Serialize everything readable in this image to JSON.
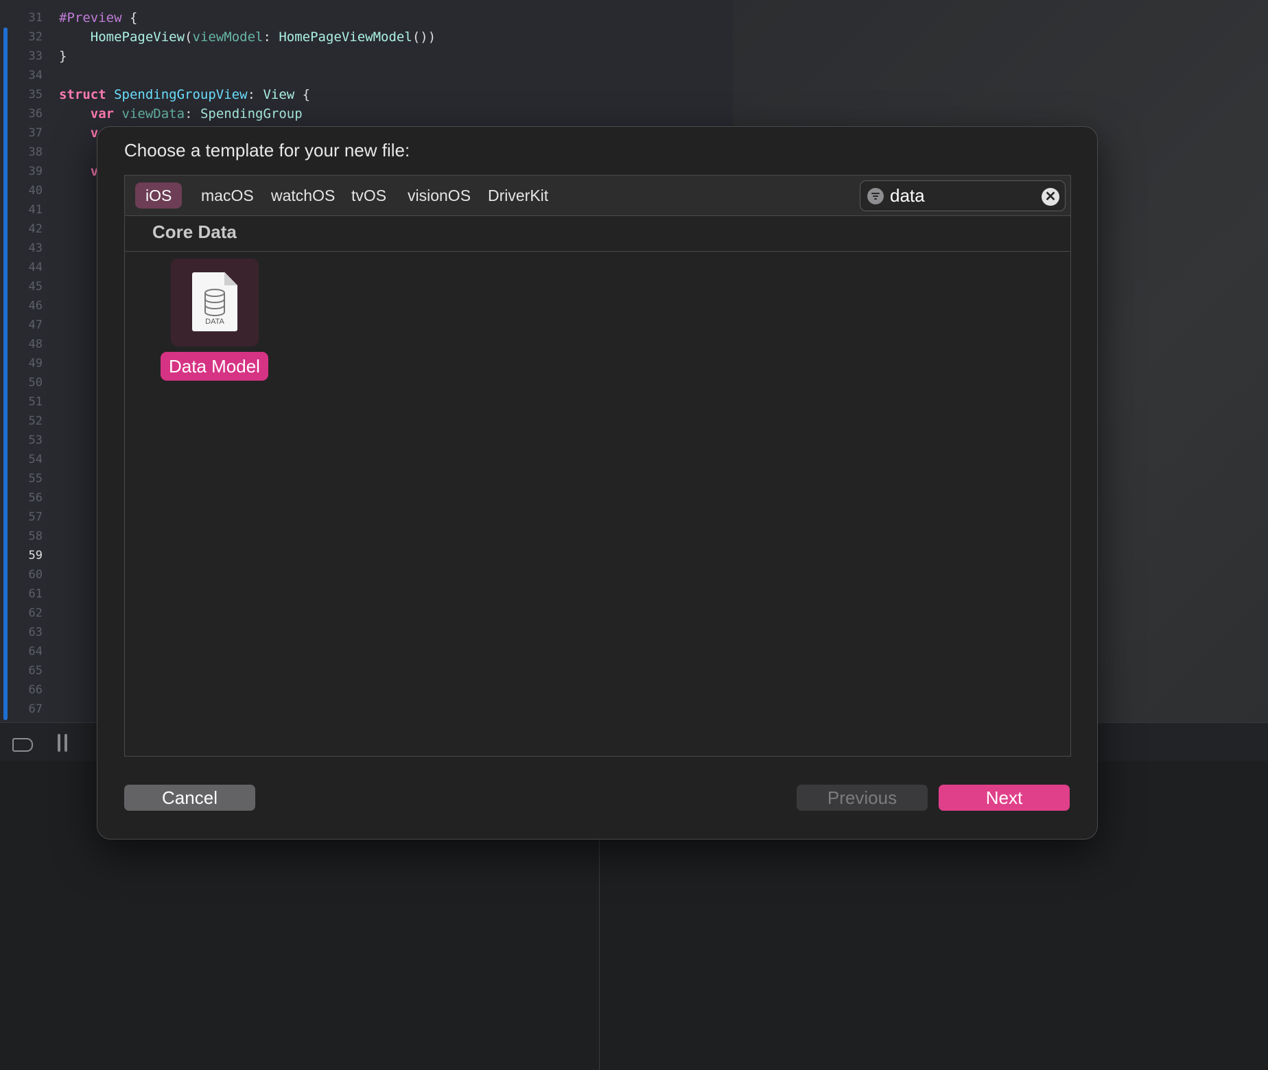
{
  "editor": {
    "lines": [
      {
        "n": "31",
        "tokens": [
          [
            "attr",
            "#Preview"
          ],
          [
            "plain",
            " {"
          ]
        ]
      },
      {
        "n": "32",
        "tokens": [
          [
            "plain",
            "    "
          ],
          [
            "type2",
            "HomePageView"
          ],
          [
            "plain",
            "("
          ],
          [
            "param",
            "viewModel"
          ],
          [
            "plain",
            ": "
          ],
          [
            "type2",
            "HomePageViewModel"
          ],
          [
            "plain",
            "())"
          ]
        ]
      },
      {
        "n": "33",
        "tokens": [
          [
            "plain",
            "}"
          ]
        ]
      },
      {
        "n": "34",
        "tokens": []
      },
      {
        "n": "35",
        "tokens": [
          [
            "kw",
            "struct"
          ],
          [
            "plain",
            " "
          ],
          [
            "type",
            "SpendingGroupView"
          ],
          [
            "plain",
            ": "
          ],
          [
            "type2",
            "View"
          ],
          [
            "plain",
            " {"
          ]
        ]
      },
      {
        "n": "36",
        "tokens": [
          [
            "plain",
            "    "
          ],
          [
            "kw",
            "var"
          ],
          [
            "plain",
            " "
          ],
          [
            "param",
            "viewData"
          ],
          [
            "plain",
            ": "
          ],
          [
            "type2",
            "SpendingGroup"
          ]
        ]
      },
      {
        "n": "37",
        "tokens": [
          [
            "plain",
            "    "
          ],
          [
            "kw",
            "v"
          ]
        ]
      },
      {
        "n": "38",
        "tokens": []
      },
      {
        "n": "39",
        "tokens": [
          [
            "plain",
            "    "
          ],
          [
            "kw",
            "v"
          ]
        ]
      },
      {
        "n": "40",
        "tokens": []
      },
      {
        "n": "41",
        "tokens": []
      },
      {
        "n": "42",
        "tokens": []
      },
      {
        "n": "43",
        "tokens": []
      },
      {
        "n": "44",
        "tokens": []
      },
      {
        "n": "45",
        "tokens": []
      },
      {
        "n": "46",
        "tokens": []
      },
      {
        "n": "47",
        "tokens": []
      },
      {
        "n": "48",
        "tokens": []
      },
      {
        "n": "49",
        "tokens": []
      },
      {
        "n": "50",
        "tokens": []
      },
      {
        "n": "51",
        "tokens": []
      },
      {
        "n": "52",
        "tokens": []
      },
      {
        "n": "53",
        "tokens": []
      },
      {
        "n": "54",
        "tokens": []
      },
      {
        "n": "55",
        "tokens": []
      },
      {
        "n": "56",
        "tokens": []
      },
      {
        "n": "57",
        "tokens": []
      },
      {
        "n": "58",
        "tokens": []
      },
      {
        "n": "59",
        "tokens": [],
        "current": true
      },
      {
        "n": "60",
        "tokens": []
      },
      {
        "n": "61",
        "tokens": []
      },
      {
        "n": "62",
        "tokens": []
      },
      {
        "n": "63",
        "tokens": []
      },
      {
        "n": "64",
        "tokens": []
      },
      {
        "n": "65",
        "tokens": []
      },
      {
        "n": "66",
        "tokens": []
      },
      {
        "n": "67",
        "tokens": []
      }
    ]
  },
  "dialog": {
    "title": "Choose a template for your new file:",
    "tabs": [
      {
        "label": "iOS",
        "selected": true
      },
      {
        "label": "macOS"
      },
      {
        "label": "watchOS"
      },
      {
        "label": "tvOS"
      },
      {
        "label": "visionOS"
      },
      {
        "label": "DriverKit"
      }
    ],
    "search": {
      "value": "data",
      "icon": "filter-icon",
      "clear_icon": "clear-icon",
      "clear_glyph": "✕"
    },
    "section_title": "Core Data",
    "templates": [
      {
        "name": "Data Model",
        "icon": "data-model-file-icon",
        "icon_label": "DATA",
        "selected": true
      }
    ],
    "buttons": {
      "cancel": "Cancel",
      "previous": "Previous",
      "next": "Next"
    }
  },
  "colors": {
    "accent": "#e0408a",
    "selected_tab": "#6d3e55",
    "dialog_bg": "#222222"
  }
}
